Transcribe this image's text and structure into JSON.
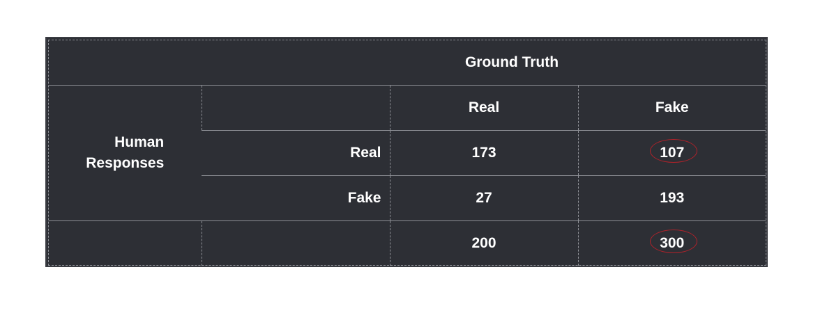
{
  "table": {
    "header": "Ground Truth",
    "row_group_label": "Human Responses",
    "row_group_label_lines": [
      "Human",
      "Responses"
    ],
    "columns": [
      "Real",
      "Fake"
    ],
    "rows": [
      {
        "label": "Real",
        "values": [
          "173",
          "107"
        ]
      },
      {
        "label": "Fake",
        "values": [
          "27",
          "193"
        ]
      }
    ],
    "totals": [
      "200",
      "300"
    ],
    "highlighted_cells": [
      "107",
      "300"
    ],
    "highlight_color": "#b0222a"
  }
}
